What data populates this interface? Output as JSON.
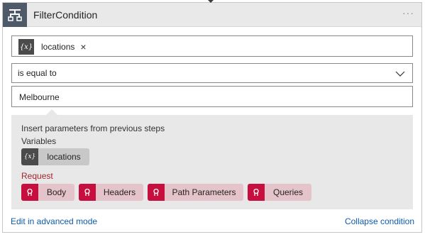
{
  "header": {
    "title": "FilterCondition",
    "more": "···"
  },
  "condition": {
    "left_operand": {
      "token_label": "locations",
      "token_icon": "{x}",
      "remove": "×"
    },
    "operator": {
      "selected": "is equal to"
    },
    "right_operand": {
      "value": "Melbourne"
    }
  },
  "dynamic_panel": {
    "hint": "Insert parameters from previous steps",
    "variables_heading": "Variables",
    "variables": [
      {
        "label": "locations",
        "icon": "{x}"
      }
    ],
    "request_heading": "Request",
    "request_items": [
      {
        "label": "Body"
      },
      {
        "label": "Headers"
      },
      {
        "label": "Path Parameters"
      },
      {
        "label": "Queries"
      }
    ],
    "colors": {
      "request_accent": "#c70f3f",
      "request_chip_bg": "#e5c3cb",
      "variable_chip_bg": "#c8c8c8"
    }
  },
  "footer": {
    "advanced_link": "Edit in advanced mode",
    "collapse_link": "Collapse condition"
  },
  "colors": {
    "header_icon_bg": "#4e5a67",
    "link": "#0f5ba8"
  }
}
